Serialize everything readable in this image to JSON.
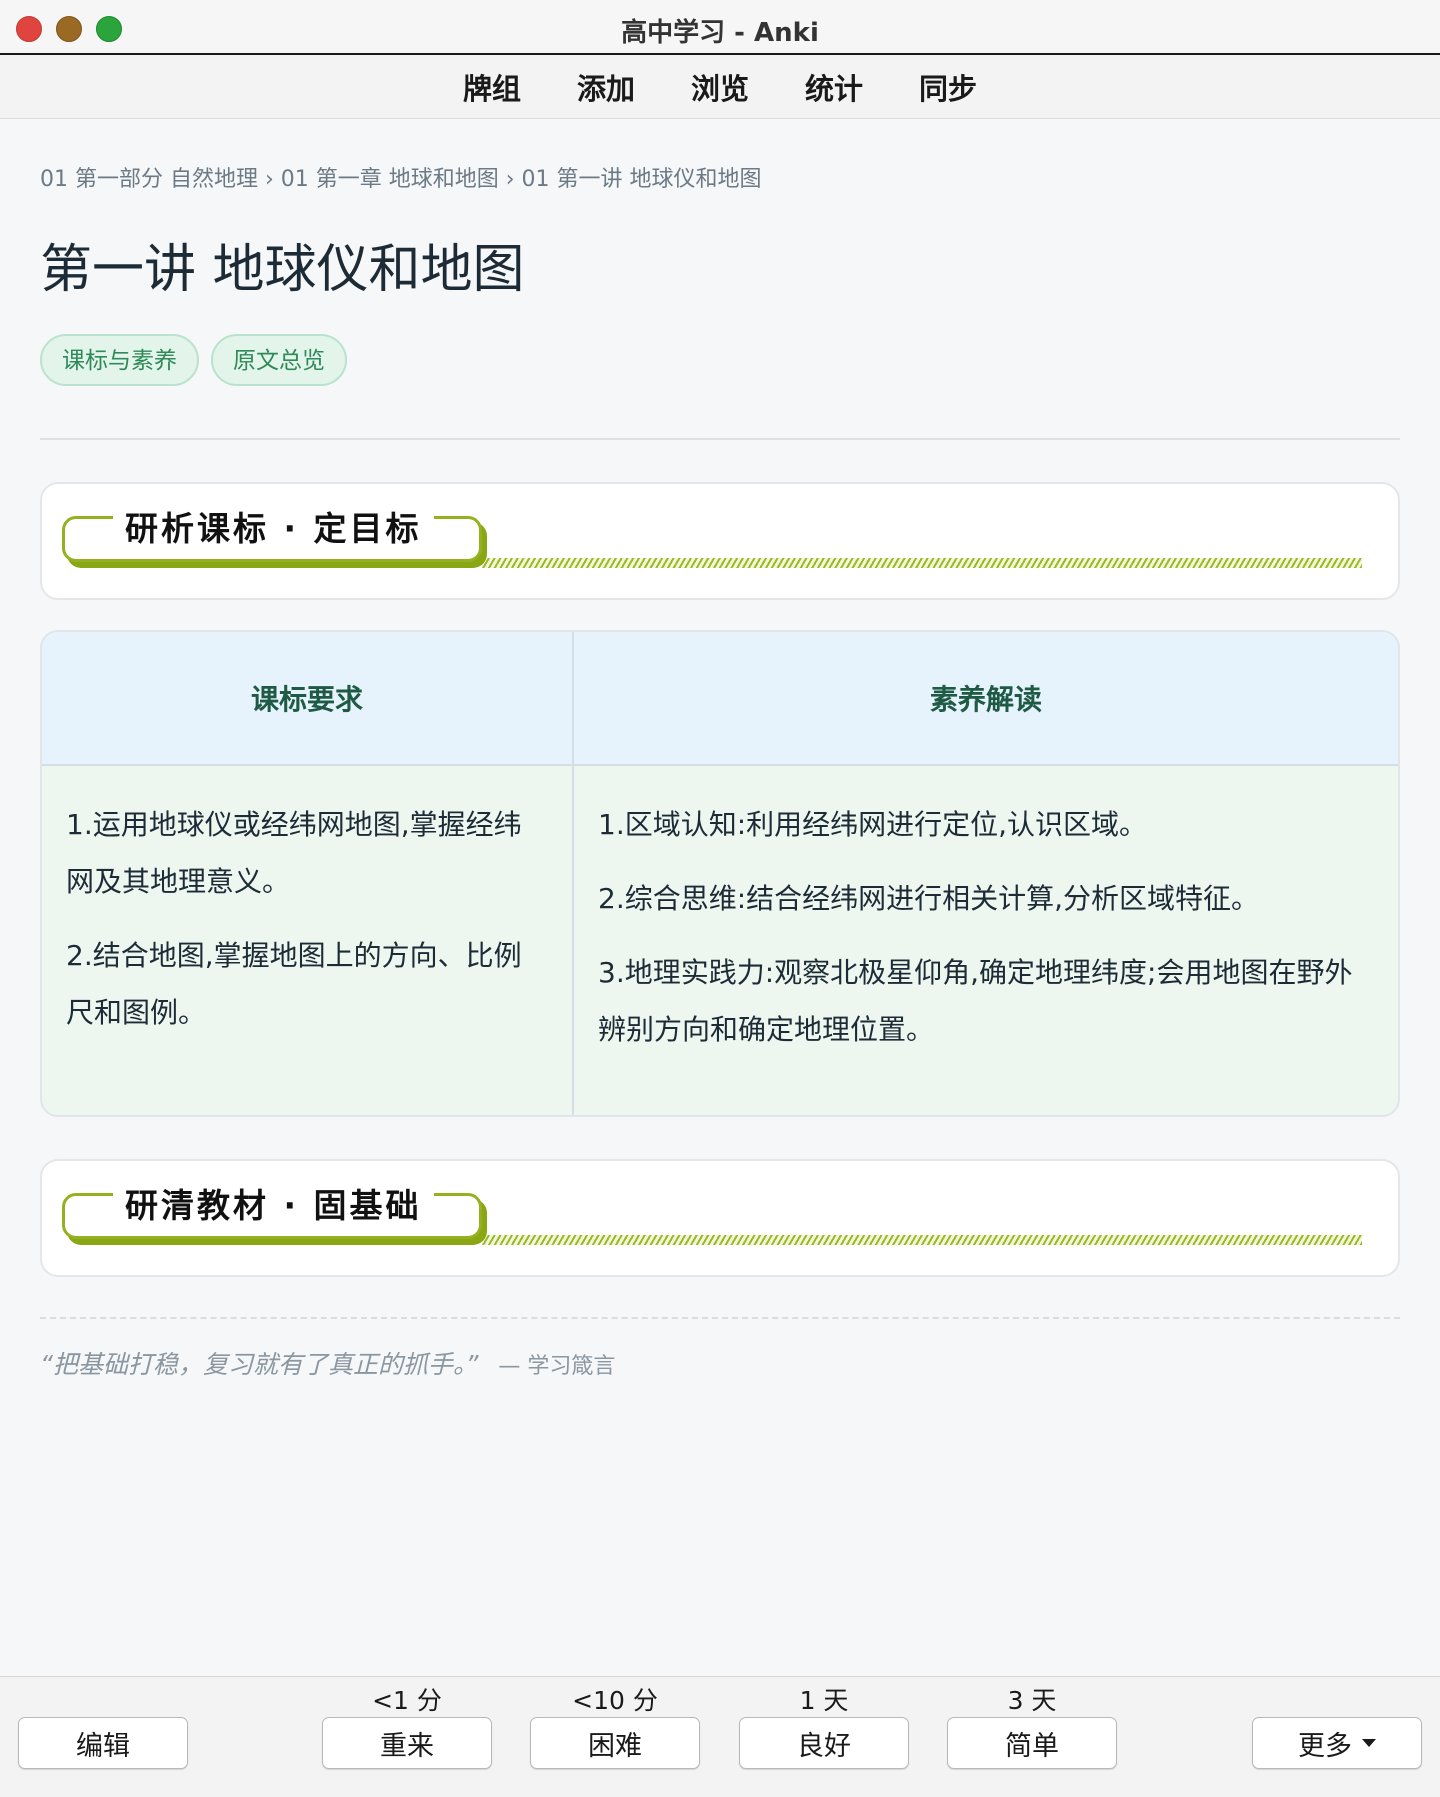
{
  "window": {
    "title": "高中学习 - Anki"
  },
  "toolbar": {
    "items": [
      "牌组",
      "添加",
      "浏览",
      "统计",
      "同步"
    ]
  },
  "breadcrumb": "01 第一部分 自然地理 › 01 第一章 地球和地图 › 01 第一讲 地球仪和地图",
  "page_title": "第一讲 地球仪和地图",
  "tags": [
    "课标与素养",
    "原文总览"
  ],
  "section1": {
    "title": "研析课标 · 定目标"
  },
  "table": {
    "headers": [
      "课标要求",
      "素养解读"
    ],
    "left": [
      "1.运用地球仪或经纬网地图,掌握经纬网及其地理意义。",
      "2.结合地图,掌握地图上的方向、比例尺和图例。"
    ],
    "right": [
      "1.区域认知:利用经纬网进行定位,认识区域。",
      "2.综合思维:结合经纬网进行相关计算,分析区域特征。",
      "3.地理实践力:观察北极星仰角,确定地理纬度;会用地图在野外辨别方向和确定地理位置。"
    ]
  },
  "section2": {
    "title": "研清教材 · 固基础"
  },
  "quote": {
    "text": "“把基础打稳，复习就有了真正的抓手。”",
    "source": "— 学习箴言"
  },
  "bottom": {
    "edit": "编辑",
    "answers": [
      {
        "interval": "<1 分",
        "label": "重来"
      },
      {
        "interval": "<10 分",
        "label": "困难"
      },
      {
        "interval": "1 天",
        "label": "良好"
      },
      {
        "interval": "3 天",
        "label": "简单"
      }
    ],
    "more": "更多"
  },
  "colors": {
    "accent_green": "#94b21f",
    "tag_green": "#2f8a5a",
    "header_blue": "#e6f3fc"
  }
}
